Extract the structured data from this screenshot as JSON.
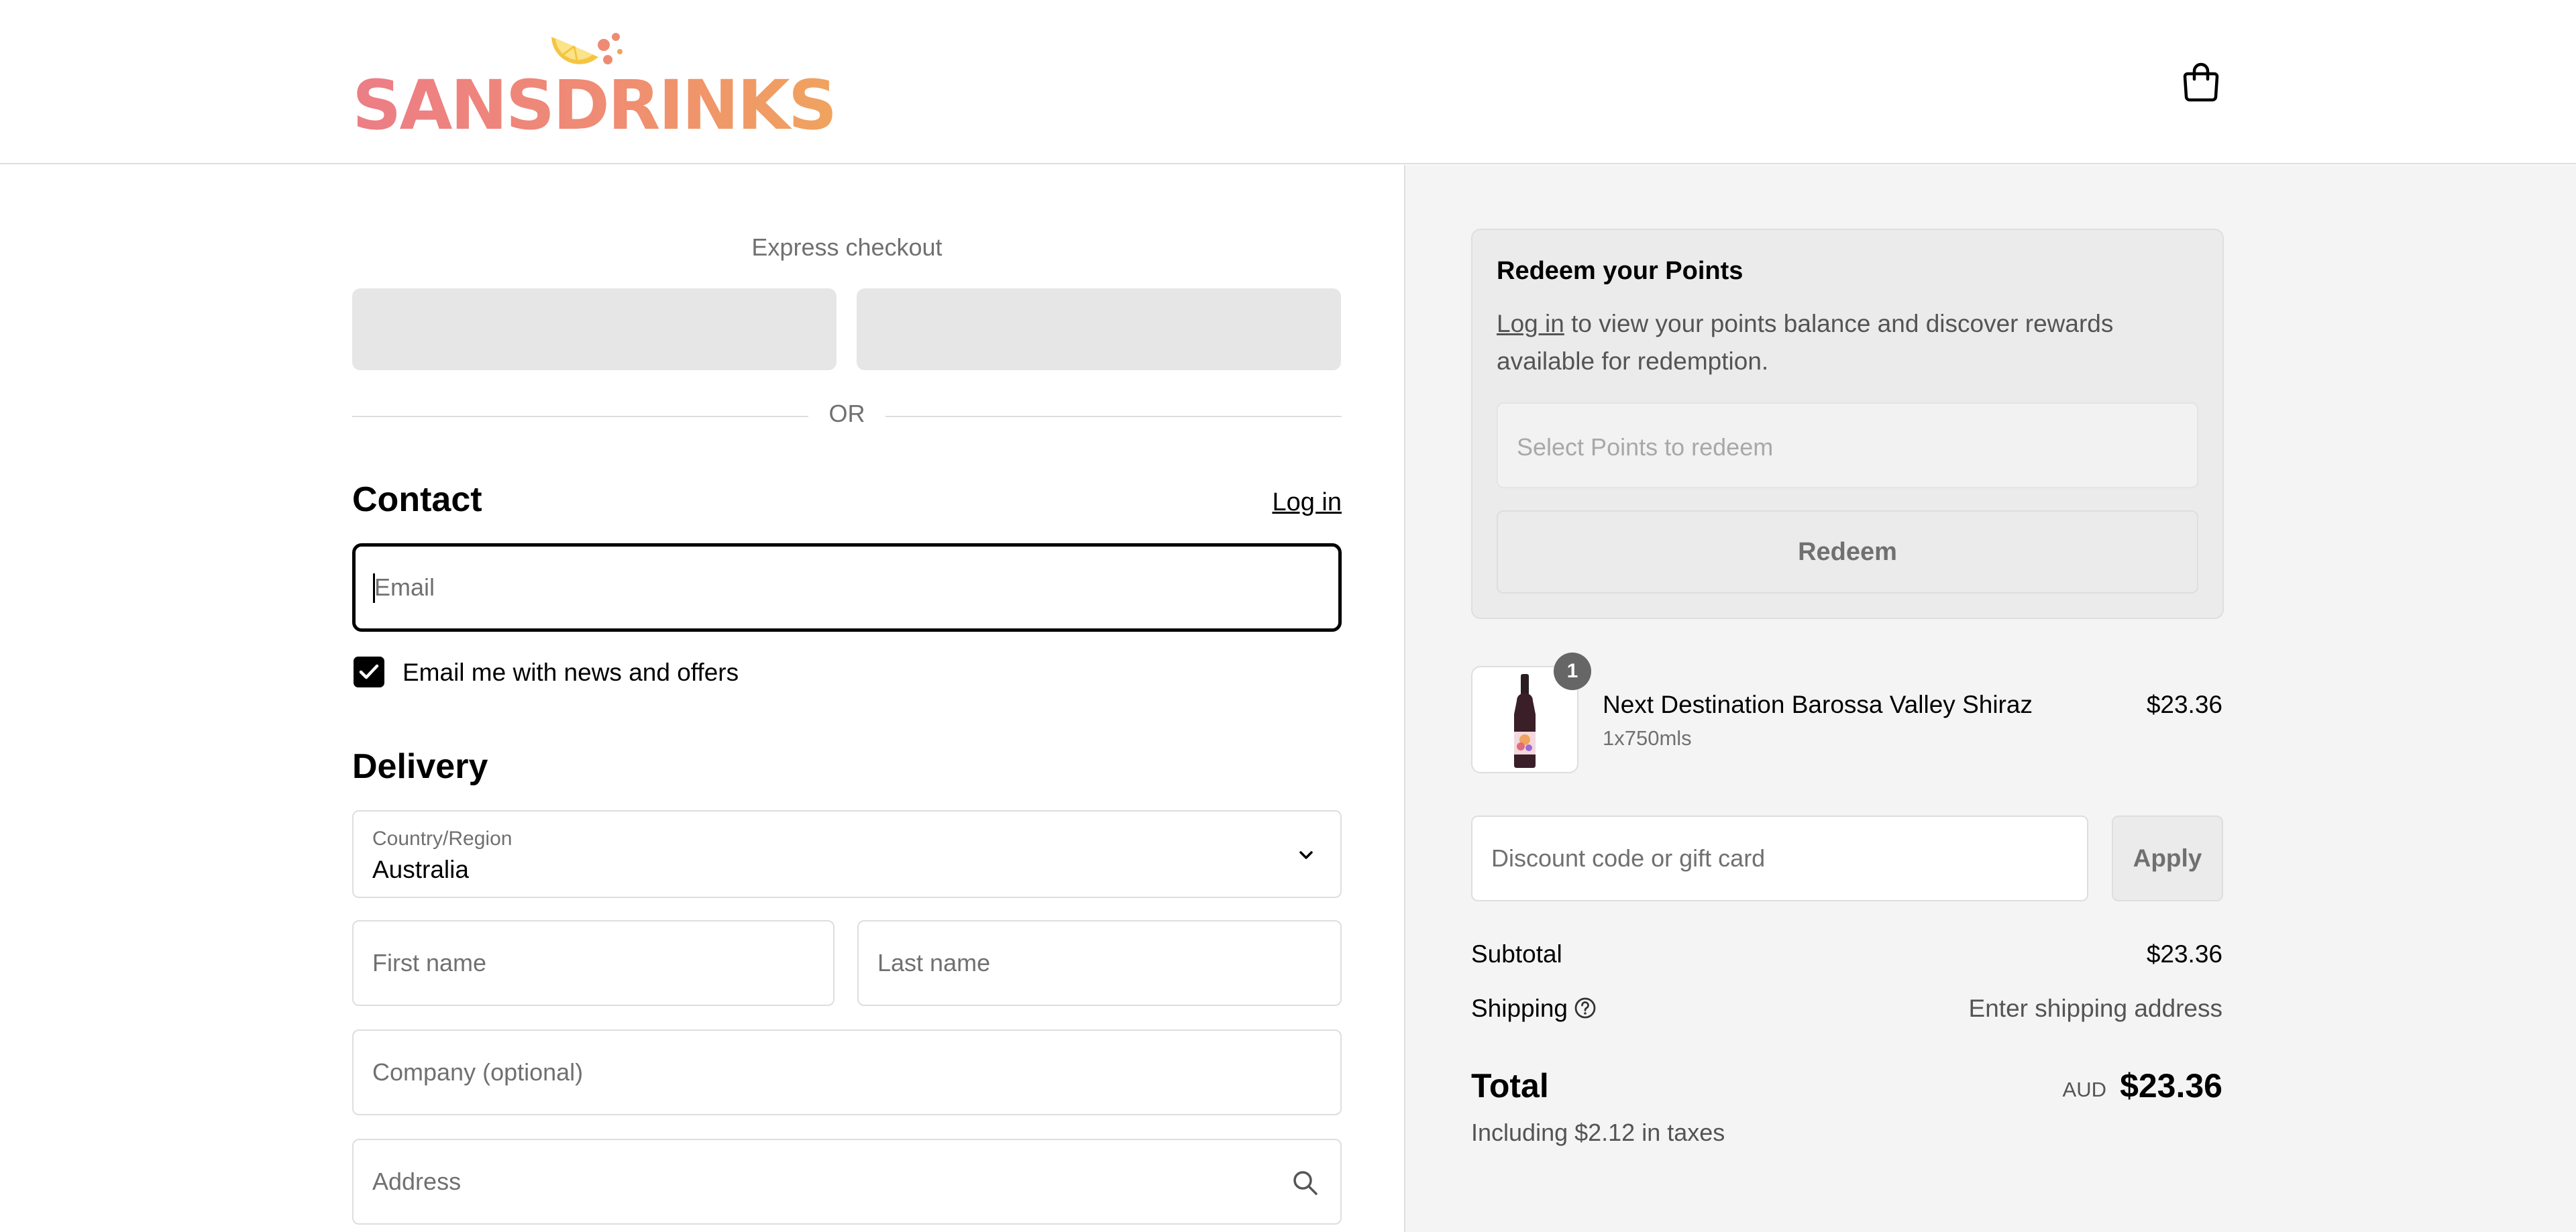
{
  "header": {
    "logo_text": "SANSDRINKS",
    "cart_icon": "shopping-bag-icon"
  },
  "express": {
    "label": "Express checkout",
    "divider": "OR"
  },
  "contact": {
    "title": "Contact",
    "login_link": "Log in",
    "email_placeholder": "Email",
    "marketing_label": "Email me with news and offers",
    "marketing_checked": true
  },
  "delivery": {
    "title": "Delivery",
    "country_label": "Country/Region",
    "country_value": "Australia",
    "first_name_placeholder": "First name",
    "last_name_placeholder": "Last name",
    "company_placeholder": "Company (optional)",
    "address_placeholder": "Address"
  },
  "points": {
    "title": "Redeem your Points",
    "login_link": "Log in",
    "description_rest": " to view your points balance and discover rewards available for redemption.",
    "select_placeholder": "Select Points to redeem",
    "redeem_label": "Redeem"
  },
  "order": {
    "items": [
      {
        "quantity": "1",
        "name": "Next Destination Barossa Valley Shiraz",
        "variant": "1x750mls",
        "price": "$23.36"
      }
    ],
    "discount_placeholder": "Discount code or gift card",
    "apply_label": "Apply",
    "subtotal_label": "Subtotal",
    "subtotal_value": "$23.36",
    "shipping_label": "Shipping",
    "shipping_value": "Enter shipping address",
    "total_label": "Total",
    "total_currency": "AUD",
    "total_value": "$23.36",
    "taxes_note": "Including $2.12 in taxes"
  },
  "colors": {
    "accent": "#000000",
    "logo_gradient_start": "#ec7d86",
    "logo_gradient_end": "#f0a35e",
    "summary_bg": "#f4f4f4"
  }
}
